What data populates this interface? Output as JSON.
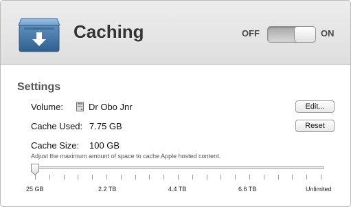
{
  "header": {
    "title": "Caching",
    "icon": "caching-box-icon",
    "switch": {
      "off_label": "OFF",
      "on_label": "ON",
      "state": "on"
    }
  },
  "settings": {
    "heading": "Settings",
    "volume": {
      "label": "Volume:",
      "value": "Dr Obo Jnr",
      "icon": "disk-icon",
      "button": "Edit..."
    },
    "cache_used": {
      "label": "Cache Used:",
      "value": "7.75 GB",
      "button": "Reset"
    },
    "cache_size": {
      "label": "Cache Size:",
      "value": "100 GB",
      "description": "Adjust the maximum amount of space to cache Apple hosted content.",
      "slider_fraction": 0.0,
      "tick_labels": [
        "25 GB",
        "2.2 TB",
        "4.4 TB",
        "6.6 TB",
        "Unlimited"
      ]
    }
  },
  "colors": {
    "header_bg": "#e6e6e6",
    "icon_blue": "#4f7fad"
  }
}
